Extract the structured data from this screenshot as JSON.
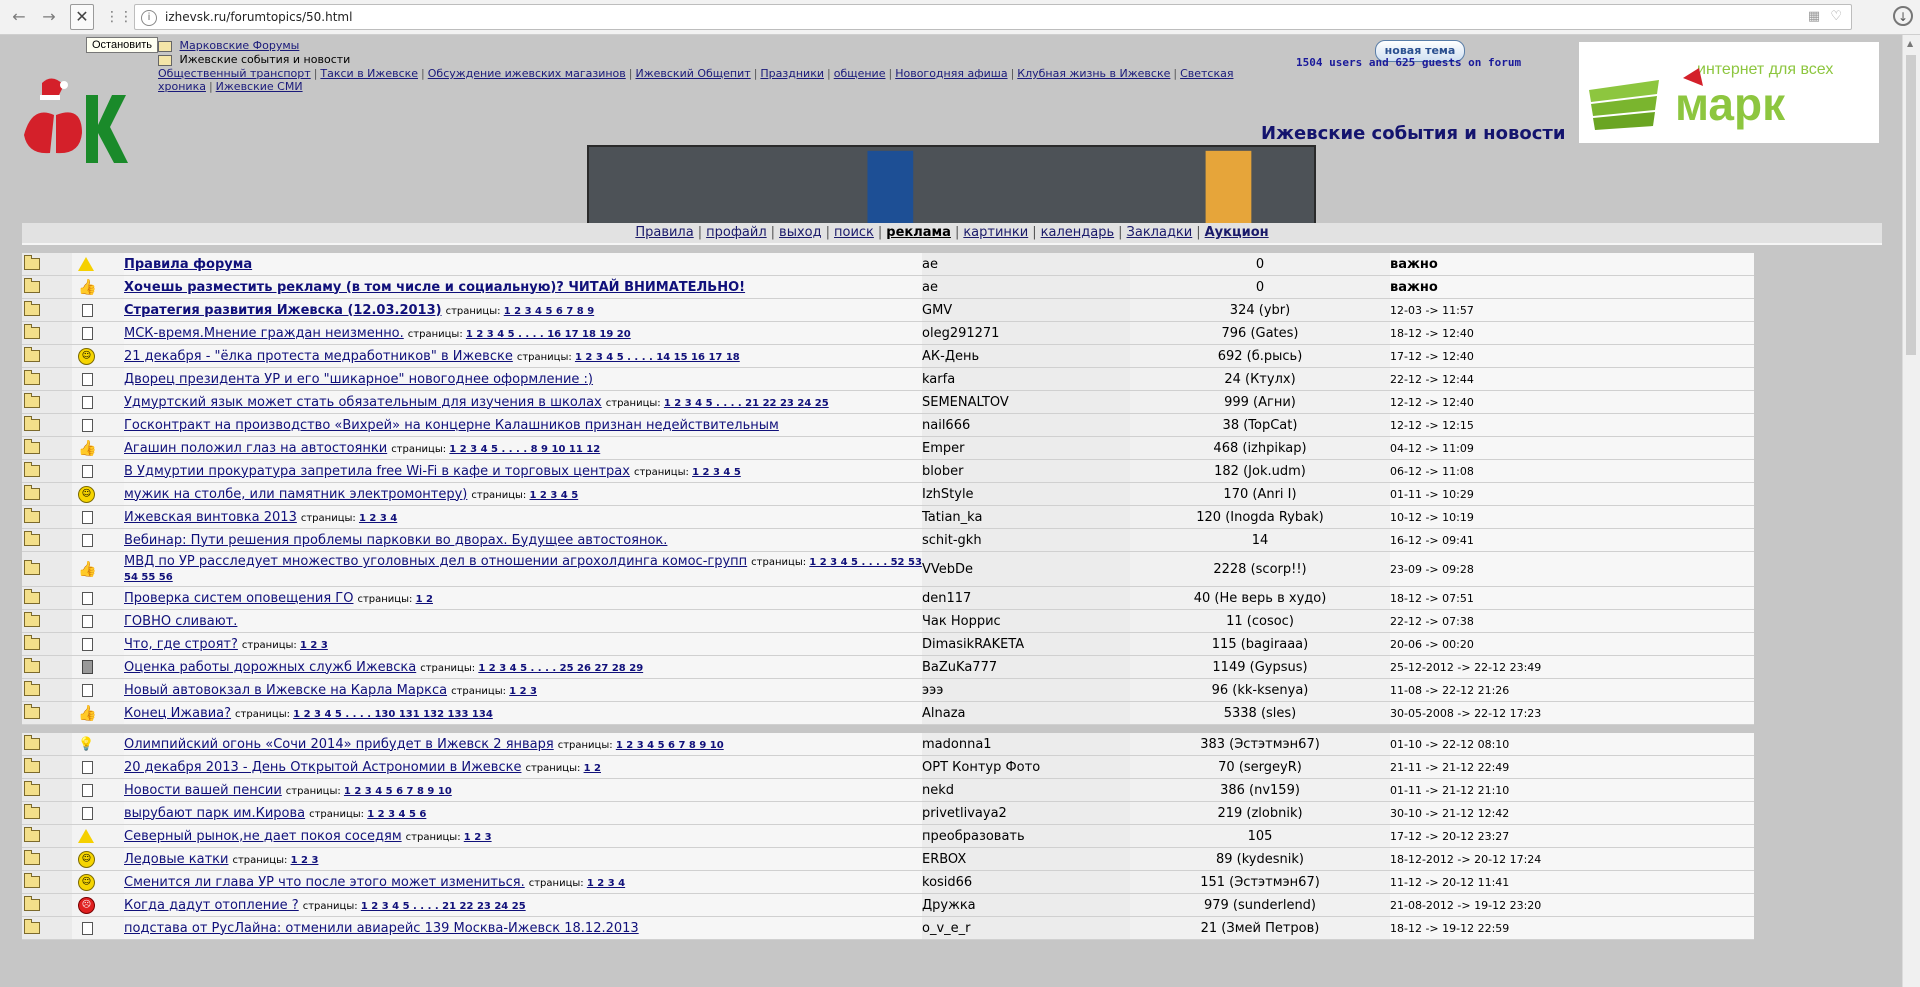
{
  "browser": {
    "url": "izhevsk.ru/forumtopics/50.html",
    "tooltip": "Остановить",
    "back_icon": "←",
    "forward_icon": "→",
    "stop_icon": "✕",
    "apps_icon": "⋮⋮",
    "info_icon": "i",
    "url_right_icons": "▦ ♡",
    "download_icon": "↓"
  },
  "header": {
    "breadcrumb_root": "Марковские Форумы",
    "breadcrumb_current": "Ижевские события и новости",
    "forums": [
      "Общественный транспорт",
      "Такси в Ижевске",
      "Обсуждение ижевских магазинов",
      "Ижевский Общепит",
      "Праздники",
      "общение",
      "Новогодняя афиша",
      "Клубная жизнь в Ижевске",
      "Светская хроника",
      "Ижевские СМИ"
    ],
    "new_topic_label": "новая тема",
    "online": "1504 users and 625 guests on forum",
    "banner_tagline": "интернет для всех",
    "banner_brand": "марк",
    "page_title": "Ижевские события и новости"
  },
  "menu": [
    {
      "label": "Правила",
      "style": "normal"
    },
    {
      "label": "профайл",
      "style": "normal"
    },
    {
      "label": "выход",
      "style": "normal"
    },
    {
      "label": "поиск",
      "style": "normal"
    },
    {
      "label": "реклама",
      "style": "bold"
    },
    {
      "label": "картинки",
      "style": "normal"
    },
    {
      "label": "календарь",
      "style": "normal"
    },
    {
      "label": "Закладки",
      "style": "normal"
    },
    {
      "label": "Аукцион",
      "style": "bold2"
    }
  ],
  "topics": [
    {
      "icon": "warn",
      "title": "Правила форума",
      "bold": true,
      "pages": "",
      "author": "ae",
      "replies": "0",
      "date": "важно",
      "important": true,
      "locked": true
    },
    {
      "icon": "thumb",
      "title": "Хочешь разместить рекламу (в том числе и социальную)? ЧИТАЙ ВНИМАТЕЛЬНО!",
      "bold": true,
      "pages": "",
      "author": "ae",
      "replies": "0",
      "date": "важно",
      "important": true,
      "locked": true
    },
    {
      "icon": "doc",
      "title": "Стратегия развития Ижевска (12.03.2013)",
      "bold": true,
      "pages": "1 2 3 4 5 6 7 8 9",
      "author": "GMV",
      "replies": "324 (ybr)",
      "date": "12-03 -> 11:57"
    },
    {
      "icon": "doc",
      "title": "МСК-время.Мнение граждан неизменно.",
      "pages": "1 2 3 4 5 . . . . 16 17 18 19 20",
      "author": "oleg291271",
      "replies": "796 (Gates)",
      "date": "18-12 -> 12:40"
    },
    {
      "icon": "smile",
      "title": "21 декабря - \"ёлка протеста медработников\" в Ижевске",
      "pages": "1 2 3 4 5 . . . . 14 15 16 17 18",
      "author": "АК-День",
      "replies": "692 (б.рысь)",
      "date": "17-12 -> 12:40"
    },
    {
      "icon": "doc",
      "title": "Дворец президента УР и его \"шикарное\" новогоднее оформление :)",
      "pages": "",
      "author": "karfa",
      "replies": "24 (Ктулх)",
      "date": "22-12 -> 12:44"
    },
    {
      "icon": "doc",
      "title": "Удмуртский язык может стать обязательным для изучения в школах",
      "pages": "1 2 3 4 5 . . . . 21 22 23 24 25",
      "author": "SEMENALTOV",
      "replies": "999 (Агни)",
      "date": "12-12 -> 12:40"
    },
    {
      "icon": "doc",
      "title": "Госконтракт на производство «Вихрей» на концерне Калашников признан недействительным",
      "pages": "",
      "author": "nail666",
      "replies": "38 (TopCat)",
      "date": "12-12 -> 12:15"
    },
    {
      "icon": "thumb",
      "title": "Агашин положил глаз на автостоянки",
      "pages": "1 2 3 4 5 . . . . 8 9 10 11 12",
      "author": "Emper",
      "replies": "468 (izhpikap)",
      "date": "04-12 -> 11:09"
    },
    {
      "icon": "doc",
      "title": "В Удмуртии прокуратура запретила free Wi-Fi в кафе и торговых центрах",
      "pages": "1 2 3 4 5",
      "author": "blober",
      "replies": "182 (Jok.udm)",
      "date": "06-12 -> 11:08"
    },
    {
      "icon": "smile",
      "title": "мужик на столбе, или памятник электромонтеру)",
      "pages": "1 2 3 4 5",
      "author": "IzhStyle",
      "replies": "170 (Anri I)",
      "date": "01-11 -> 10:29"
    },
    {
      "icon": "doc",
      "title": "Ижевская винтовка 2013",
      "pages": "1 2 3 4",
      "author": "Tatian_ka",
      "replies": "120 (Inogda Rybak)",
      "date": "10-12 -> 10:19"
    },
    {
      "icon": "doc",
      "title": "Вебинар: Пути решения проблемы парковки во дворах. Будущее автостоянок.",
      "pages": "",
      "author": "schit-gkh",
      "replies": "14",
      "date": "16-12 -> 09:41"
    },
    {
      "icon": "thumb",
      "title": "МВД по УР расследует множество уголовных дел в отношении агрохолдинга комос-групп",
      "pages": "1 2 3 4 5 . . . . 52 53 54 55 56",
      "author": "VVebDe",
      "replies": "2228 (scorp!!)",
      "date": "23-09 -> 09:28",
      "tall": true
    },
    {
      "icon": "doc",
      "title": "Проверка систем оповещения ГО",
      "pages": "1 2",
      "author": "den117",
      "replies": "40 (Не верь в худо)",
      "date": "18-12 -> 07:51"
    },
    {
      "icon": "doc",
      "title": "ГОВНО сливают.",
      "pages": "",
      "author": "Чак Норрис",
      "replies": "11 (cosoc)",
      "date": "22-12 -> 07:38"
    },
    {
      "icon": "doc",
      "title": "Что, где строят?",
      "pages": "1 2 3",
      "author": "DimasikRAKETA",
      "replies": "115 (bagiraaa)",
      "date": "20-06 -> 00:20"
    },
    {
      "icon": "calc",
      "title": "Оценка работы дорожных служб Ижевска",
      "pages": "1 2 3 4 5 . . . . 25 26 27 28 29",
      "author": "BaZuKa777",
      "replies": "1149 (Gypsus)",
      "date": "25-12-2012 -> 22-12 23:49"
    },
    {
      "icon": "doc",
      "title": "Новый автовокзал в Ижевске на Карла Маркса",
      "pages": "1 2 3",
      "author": "эээ",
      "replies": "96 (kk-ksenya)",
      "date": "11-08 -> 22-12 21:26"
    },
    {
      "icon": "thumb",
      "title": "Конец Ижавиа?",
      "pages": "1 2 3 4 5 . . . . 130 131 132 133 134",
      "author": "Alnaza",
      "replies": "5338 (sles)",
      "date": "30-05-2008 -> 22-12 17:23"
    },
    {
      "spacer": true
    },
    {
      "icon": "bulb",
      "title": "Олимпийский огонь «Сочи 2014» прибудет в Ижевск 2 января",
      "pages": "1 2 3 4 5 6 7 8 9 10",
      "author": "madonna1",
      "replies": "383 (Эстэтмэн67)",
      "date": "01-10 -> 22-12 08:10"
    },
    {
      "icon": "doc",
      "title": "20 декабря 2013 - День Открытой Астрономии в Ижевске",
      "pages": "1 2",
      "author": "ОРТ Контур Фото",
      "replies": "70 (sergeyR)",
      "date": "21-11 -> 21-12 22:49"
    },
    {
      "icon": "doc",
      "title": "Новости вашей пенсии",
      "pages": "1 2 3 4 5 6 7 8 9 10",
      "author": "nekd",
      "replies": "386 (nv159)",
      "date": "01-11 -> 21-12 21:10"
    },
    {
      "icon": "doc",
      "title": "вырубают парк им.Кирова",
      "pages": "1 2 3 4 5 6",
      "author": "privetlivaya2",
      "replies": "219 (zlobnik)",
      "date": "30-10 -> 21-12 12:42"
    },
    {
      "icon": "warn",
      "title": "Северный рынок,не дает покоя соседям",
      "pages": "1 2 3",
      "author": "преобразовать",
      "replies": "105",
      "date": "17-12 -> 20-12 23:27"
    },
    {
      "icon": "smile",
      "title": "Ледовые катки",
      "pages": "1 2 3",
      "author": "ERBOX",
      "replies": "89 (kydesnik)",
      "date": "18-12-2012 -> 20-12 17:24"
    },
    {
      "icon": "smile",
      "title": "Сменится ли глава УР что после этого может измениться.",
      "pages": "1 2 3 4",
      "author": "kosid66",
      "replies": "151 (Эстэтмэн67)",
      "date": "11-12 -> 20-12 11:41"
    },
    {
      "icon": "mad",
      "title": "Когда дадут отопление ?",
      "pages": "1 2 3 4 5 . . . . 21 22 23 24 25",
      "author": "Дружка",
      "replies": "979 (sunderlend)",
      "date": "21-08-2012 -> 19-12 23:20"
    },
    {
      "icon": "doc",
      "title": "подстава от РусЛайна: отменили авиарейс 139 Москва-Ижевск 18.12.2013",
      "pages": "",
      "author": "o_v_e_r",
      "replies": "21 (Змей Петров)",
      "date": "18-12 -> 19-12 22:59"
    }
  ],
  "pages_label": "страницы:",
  "colors": {
    "link": "#10107a",
    "title": "#14146e",
    "bg": "#c6c6c6"
  }
}
